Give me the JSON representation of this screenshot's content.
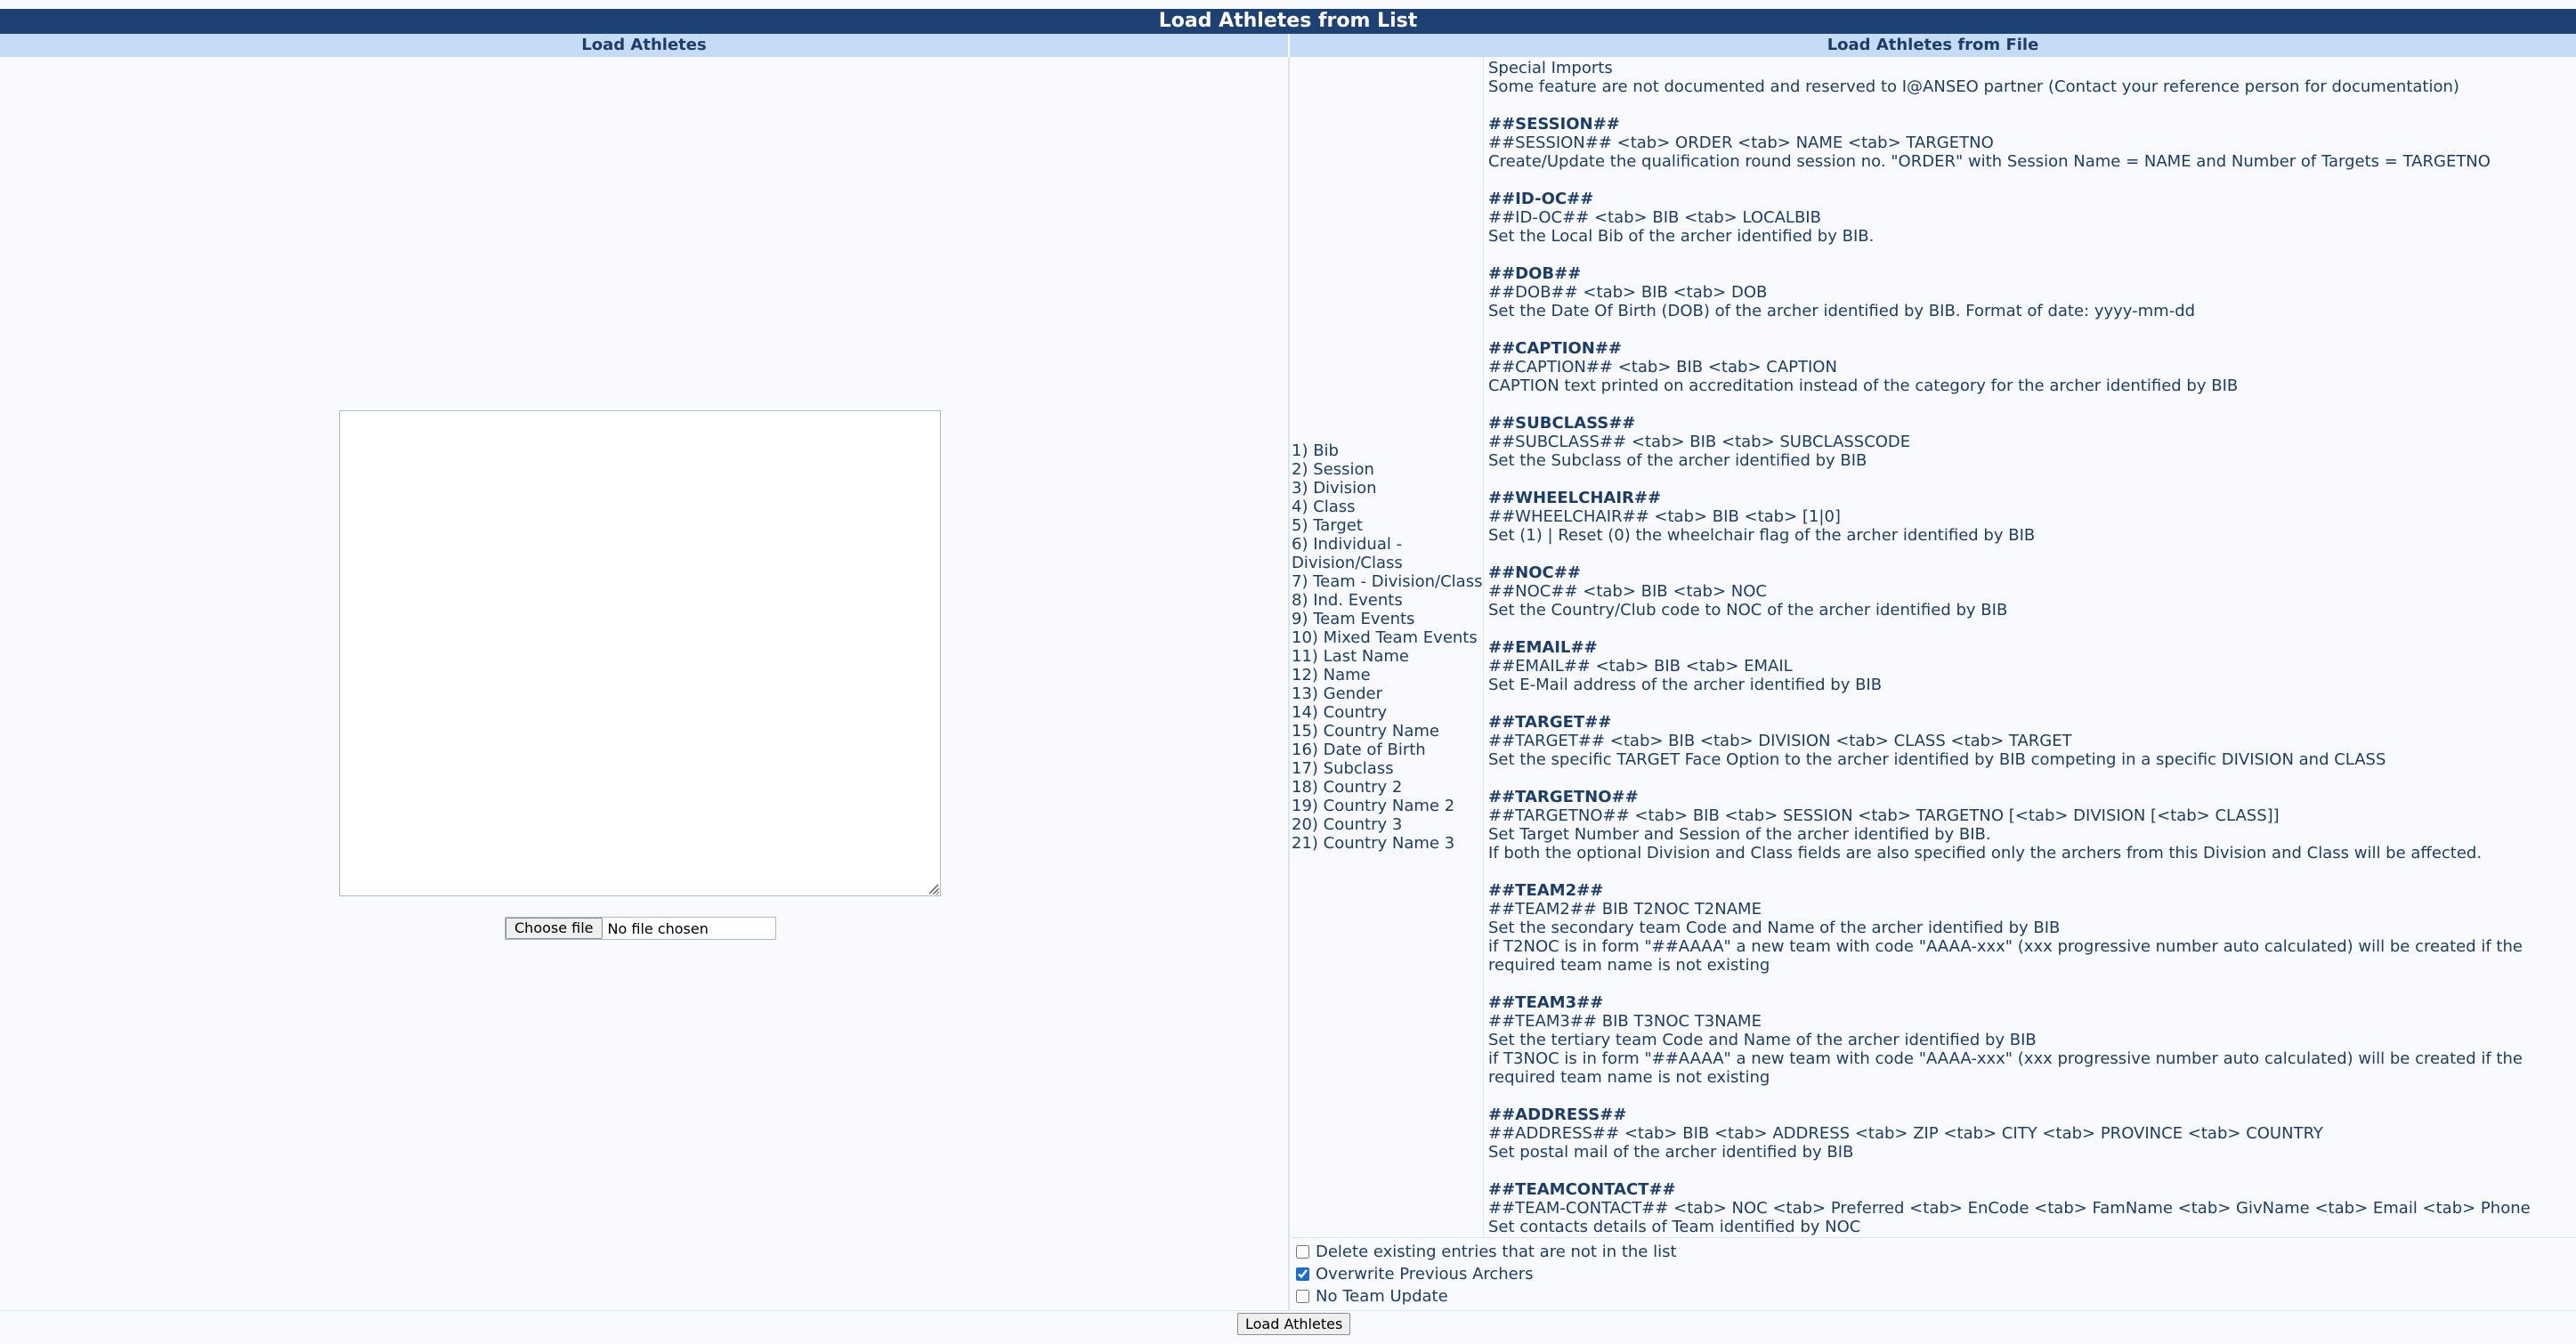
{
  "title": "Load Athletes from List",
  "left_header": "Load Athletes",
  "right_header": "Load Athletes from File",
  "file_input": {
    "button_label": "Choose file",
    "status": "No file chosen"
  },
  "fields": [
    "1) Bib",
    "2) Session",
    "3) Division",
    "4) Class",
    "5) Target",
    "6) Individual - Division/Class",
    "7) Team - Division/Class",
    "8) Ind. Events",
    "9) Team Events",
    "10) Mixed Team Events",
    "11) Last Name",
    "12) Name",
    "13) Gender",
    "14) Country",
    "15) Country Name",
    "16) Date of Birth",
    "17) Subclass",
    "18) Country 2",
    "19) Country Name 2",
    "20) Country 3",
    "21) Country Name 3"
  ],
  "instructions": {
    "heading": "Special Imports",
    "note": "Some feature are not documented and reserved to I@ANSEO partner (Contact your reference person for documentation)",
    "blocks": [
      {
        "code": "##SESSION##",
        "syntax": "##SESSION## <tab> ORDER <tab> NAME <tab> TARGETNO",
        "desc": [
          "Create/Update the qualification round session no. \"ORDER\" with Session Name = NAME and Number of Targets = TARGETNO"
        ]
      },
      {
        "code": "##ID-OC##",
        "syntax": "##ID-OC## <tab> BIB <tab> LOCALBIB",
        "desc": [
          "Set the Local Bib of the archer identified by BIB."
        ]
      },
      {
        "code": "##DOB##",
        "syntax": "##DOB## <tab> BIB <tab> DOB",
        "desc": [
          "Set the Date Of Birth (DOB) of the archer identified by BIB. Format of date: yyyy-mm-dd"
        ]
      },
      {
        "code": "##CAPTION##",
        "syntax": "##CAPTION## <tab> BIB <tab> CAPTION",
        "desc": [
          "CAPTION text printed on accreditation instead of the category for the archer identified by BIB"
        ]
      },
      {
        "code": "##SUBCLASS##",
        "syntax": "##SUBCLASS## <tab> BIB <tab> SUBCLASSCODE",
        "desc": [
          "Set the Subclass of the archer identified by BIB"
        ]
      },
      {
        "code": "##WHEELCHAIR##",
        "syntax": "##WHEELCHAIR## <tab> BIB <tab> [1|0]",
        "desc": [
          "Set (1) | Reset (0) the wheelchair flag of the archer identified by BIB"
        ]
      },
      {
        "code": "##NOC##",
        "syntax": "##NOC## <tab> BIB <tab> NOC",
        "desc": [
          "Set the Country/Club code to NOC of the archer identified by BIB"
        ]
      },
      {
        "code": "##EMAIL##",
        "syntax": "##EMAIL## <tab> BIB <tab> EMAIL",
        "desc": [
          "Set E-Mail address of the archer identified by BIB"
        ]
      },
      {
        "code": "##TARGET##",
        "syntax": "##TARGET## <tab> BIB <tab> DIVISION <tab> CLASS <tab> TARGET",
        "desc": [
          "Set the specific TARGET Face Option to the archer identified by BIB competing in a specific DIVISION and CLASS"
        ]
      },
      {
        "code": "##TARGETNO##",
        "syntax": "##TARGETNO## <tab> BIB <tab> SESSION <tab> TARGETNO [<tab> DIVISION [<tab> CLASS]]",
        "desc": [
          "Set Target Number and Session of the archer identified by BIB.",
          "If both the optional Division and Class fields are also specified only the archers from this Division and Class will be affected."
        ]
      },
      {
        "code": "##TEAM2##",
        "syntax": "##TEAM2##  BIB  T2NOC  T2NAME",
        "desc": [
          "Set the secondary team Code and Name of the archer identified by BIB",
          "if T2NOC is in form \"##AAAA\" a new team with code \"AAAA-xxx\" (xxx progressive number auto calculated) will be created if the required team name is not existing"
        ]
      },
      {
        "code": "##TEAM3##",
        "syntax": "##TEAM3##  BIB  T3NOC  T3NAME",
        "desc": [
          "Set the tertiary team Code and Name of the archer identified by BIB",
          "if T3NOC is in form \"##AAAA\" a new team with code \"AAAA-xxx\" (xxx progressive number auto calculated) will be created if the required team name is not existing"
        ]
      },
      {
        "code": "##ADDRESS##",
        "syntax": "##ADDRESS## <tab> BIB <tab> ADDRESS <tab> ZIP <tab> CITY <tab> PROVINCE <tab> COUNTRY",
        "desc": [
          "Set postal mail of the archer identified by BIB"
        ]
      },
      {
        "code": "##TEAMCONTACT##",
        "syntax": "##TEAM-CONTACT## <tab> NOC <tab> Preferred <tab> EnCode <tab> FamName <tab> GivName <tab> Email <tab> Phone",
        "desc": [
          "Set contacts details of Team identified by NOC"
        ]
      }
    ]
  },
  "options": [
    {
      "label": "Delete existing entries that are not in the list",
      "checked": false
    },
    {
      "label": "Overwrite Previous Archers",
      "checked": true
    },
    {
      "label": "No Team Update",
      "checked": false
    }
  ],
  "submit_label": "Load Athletes"
}
